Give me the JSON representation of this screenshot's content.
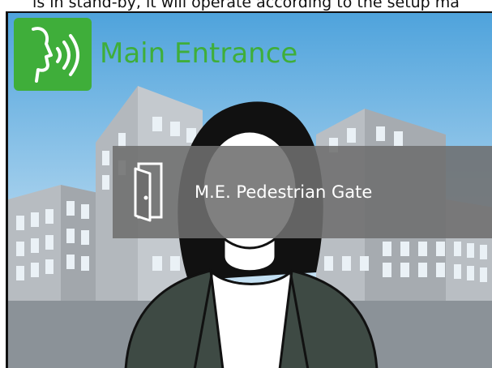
{
  "caption": {
    "text": "is in stand-by, it will operate according to the setup ma"
  },
  "header": {
    "location_title": "Main Entrance",
    "icon": "speaking-head-icon"
  },
  "gate": {
    "label": "M.E. Pedestrian Gate",
    "icon": "door-open-icon"
  },
  "colors": {
    "brand_green": "#3fae3a",
    "panel_gray": "#6e6e6e",
    "sky_top": "#4fa3dc",
    "sky_bottom": "#c9e2f3",
    "street": "#8b9298",
    "jacket": "#3e4a44",
    "hair": "#111111"
  }
}
